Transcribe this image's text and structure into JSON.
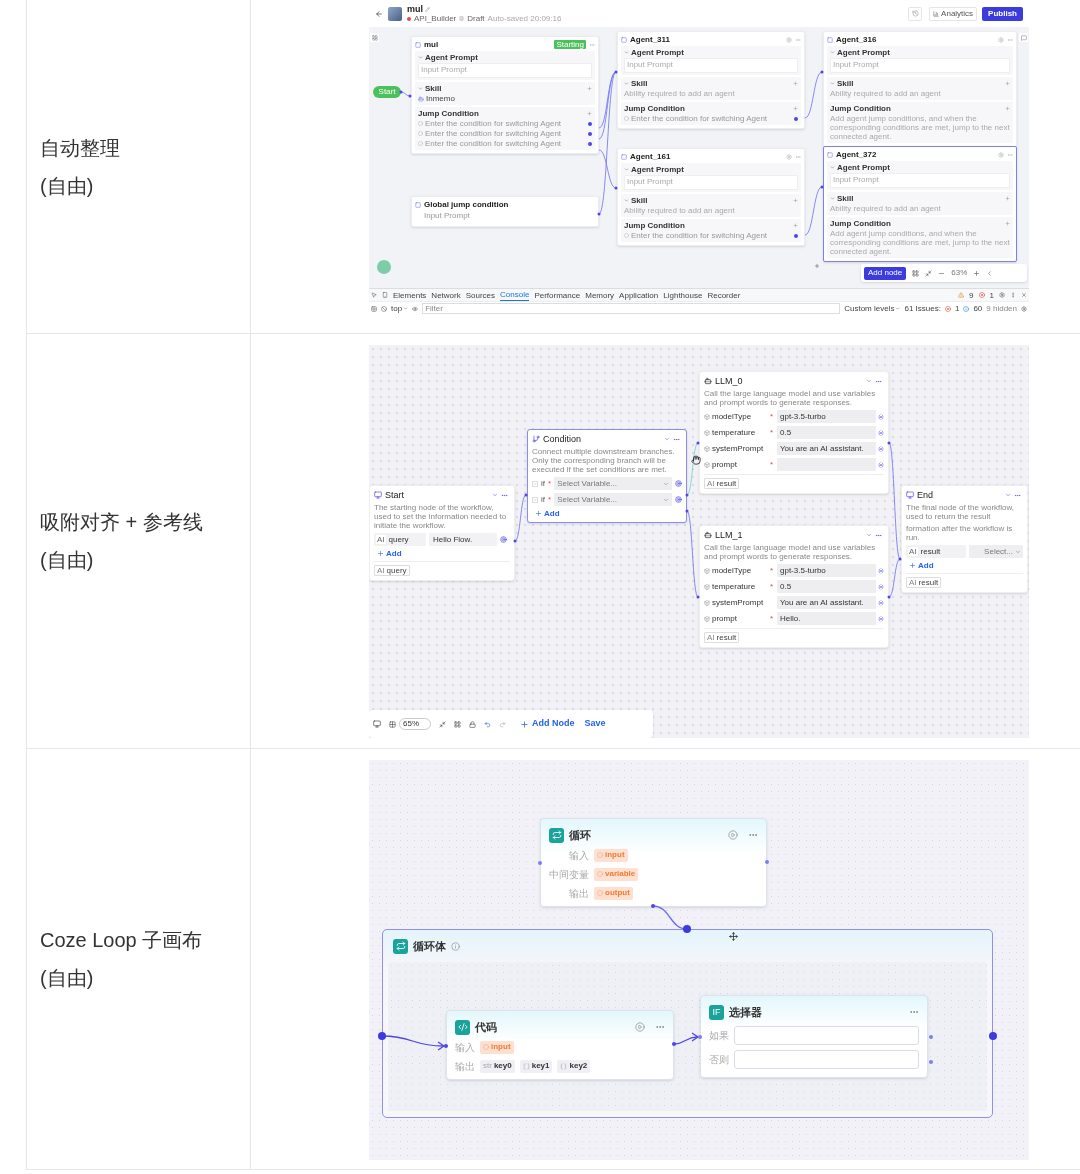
{
  "rows": [
    {
      "label": "自动整理",
      "note": "(自由)",
      "screen": {
        "kind": "agent_flow",
        "header": {
          "title": "mul",
          "project": "API_Builder",
          "status": "Draft",
          "saved": "Auto-saved 20:09:16",
          "actions": [
            {
              "kind": "secondary",
              "label": "Analytics"
            },
            {
              "kind": "primary",
              "label": "Publish"
            }
          ]
        },
        "start": "Start",
        "nodes": [
          {
            "kind": "agent",
            "title": "mul",
            "badge": "Starting",
            "selected": false,
            "prompt_label": "Agent Prompt",
            "prompt_placeholder": "Input Prompt",
            "skill_label": "Skill",
            "skills": [
              "Inmemo"
            ],
            "jump_label": "Jump Condition",
            "conditions": [
              {
                "text": "Enter the condition for switching Agent",
                "connected": true
              },
              {
                "text": "Enter the condition for switching Agent",
                "connected": true
              },
              {
                "text": "Enter the condition for switching Agent",
                "connected": true
              }
            ]
          },
          {
            "kind": "agent",
            "title": "Agent_311",
            "selected": false,
            "prompt_label": "Agent Prompt",
            "prompt_placeholder": "Input Prompt",
            "skill_label": "Skill",
            "skill_hint": "Ability required to add an agent",
            "jump_label": "Jump Condition",
            "conditions": [
              {
                "text": "Enter the condition for switching Agent",
                "connected": true
              }
            ]
          },
          {
            "kind": "agent",
            "title": "Agent_161",
            "selected": false,
            "prompt_label": "Agent Prompt",
            "prompt_placeholder": "Input Prompt",
            "skill_label": "Skill",
            "skill_hint": "Ability required to add an agent",
            "jump_label": "Jump Condition",
            "conditions": [
              {
                "text": "Enter the condition for switching Agent",
                "connected": true
              }
            ]
          },
          {
            "kind": "agent",
            "title": "Agent_316",
            "selected": false,
            "prompt_label": "Agent Prompt",
            "prompt_placeholder": "Input Prompt",
            "skill_label": "Skill",
            "skill_hint": "Ability required to add an agent",
            "jump_label": "Jump Condition",
            "jump_hint": "Add agent jump conditions, and when the corresponding conditions are met, jump to the next connected agent."
          },
          {
            "kind": "agent",
            "title": "Agent_372",
            "selected": true,
            "prompt_label": "Agent Prompt",
            "prompt_placeholder": "Input Prompt",
            "skill_label": "Skill",
            "skill_hint": "Ability required to add an agent",
            "jump_label": "Jump Condition",
            "jump_hint": "Add agent jump conditions, and when the corresponding conditions are met, jump to the next connected agent."
          },
          {
            "kind": "global",
            "title": "Global jump condition",
            "prompt_placeholder": "Input Prompt"
          }
        ],
        "toolbar": {
          "add": "Add node",
          "zoom": "63%"
        },
        "devtools": {
          "tabs": [
            {
              "label": "Elements",
              "selected": false
            },
            {
              "label": "Network",
              "selected": false
            },
            {
              "label": "Sources",
              "selected": false
            },
            {
              "label": "Console",
              "selected": true
            },
            {
              "label": "Performance",
              "selected": false
            },
            {
              "label": "Memory",
              "selected": false
            },
            {
              "label": "Application",
              "selected": false
            },
            {
              "label": "Lighthouse",
              "selected": false
            },
            {
              "label": "Recorder",
              "selected": false
            }
          ],
          "warnings": "9",
          "errors": "1",
          "context": "top",
          "filter_placeholder": "Filter",
          "levels": "Custom levels",
          "issues": "61 Issues:",
          "issue_errors": "1",
          "issue_info": "60",
          "hidden": "9 hidden"
        }
      }
    },
    {
      "label": "吸附对齐 + 参考线",
      "note": "(自由)",
      "screen": {
        "kind": "workflow",
        "nodes": [
          {
            "kind": "start",
            "title": "Start",
            "desc": "The starting node of the workflow, used to set the information needed to initiate the workflow.",
            "inputs": [
              {
                "type": "AI",
                "name": "query",
                "value": "Hello Flow."
              }
            ],
            "add": "Add",
            "outputs": [
              {
                "type": "AI",
                "name": "query"
              }
            ]
          },
          {
            "kind": "condition",
            "title": "Condition",
            "desc": "Connect multiple downstream branches. Only the corresponding branch will be executed if the set conditions are met.",
            "branches": [
              {
                "label": "if",
                "required_mark": "*",
                "placeholder": "Select Variable..."
              },
              {
                "label": "if",
                "required_mark": "*",
                "placeholder": "Select Variable..."
              }
            ],
            "add": "Add"
          },
          {
            "kind": "llm",
            "title": "LLM_0",
            "desc": "Call the large language model and use variables and prompt words to generate responses.",
            "params": [
              {
                "name": "modelType",
                "required_mark": "*",
                "value": "gpt-3.5-turbo"
              },
              {
                "name": "temperature",
                "required_mark": "*",
                "value": "0.5"
              },
              {
                "name": "systemPrompt",
                "value": "You are an AI assistant."
              },
              {
                "name": "prompt",
                "required_mark": "*"
              }
            ],
            "outputs": [
              {
                "type": "AI",
                "name": "result"
              }
            ]
          },
          {
            "kind": "llm",
            "title": "LLM_1",
            "desc": "Call the large language model and use variables and prompt words to generate responses.",
            "params": [
              {
                "name": "modelType",
                "required_mark": "*",
                "value": "gpt-3.5-turbo"
              },
              {
                "name": "temperature",
                "required_mark": "*",
                "value": "0.5"
              },
              {
                "name": "systemPrompt",
                "value": "You are an AI assistant."
              },
              {
                "name": "prompt",
                "required_mark": "*",
                "value": "Hello."
              }
            ],
            "outputs": [
              {
                "type": "AI",
                "name": "result"
              }
            ]
          },
          {
            "kind": "end",
            "title": "End",
            "desc_lines": [
              "The final node of the workflow, used to return the result",
              "formation after the workflow is run."
            ],
            "inputs": [
              {
                "type": "AI",
                "name": "result",
                "placeholder": "Select..."
              }
            ],
            "add": "Add",
            "outputs": [
              {
                "type": "AI",
                "name": "result"
              }
            ]
          }
        ],
        "toolbar": {
          "zoom": "65%",
          "add": "Add Node",
          "save": "Save"
        }
      }
    },
    {
      "label": "Coze Loop 子画布",
      "note": "(自由)",
      "screen": {
        "kind": "loop",
        "loop": {
          "title": "循环",
          "rows": [
            {
              "label": "输入",
              "value": "input"
            },
            {
              "label": "中间变量",
              "value": "variable"
            },
            {
              "label": "输出",
              "value": "output"
            }
          ]
        },
        "body": {
          "title": "循环体"
        },
        "code": {
          "title": "代码",
          "input_label": "输入",
          "inputs": [
            "input"
          ],
          "output_label": "输出",
          "outputs": [
            {
              "kind": "string",
              "type_label": "str",
              "name": "key0"
            },
            {
              "kind": "array",
              "name": "key1"
            },
            {
              "kind": "object",
              "name": "key2"
            }
          ]
        },
        "selector": {
          "title": "选择器",
          "icon_text": "IF",
          "rows": [
            {
              "label": "如果"
            },
            {
              "label": "否则"
            }
          ]
        }
      }
    }
  ]
}
